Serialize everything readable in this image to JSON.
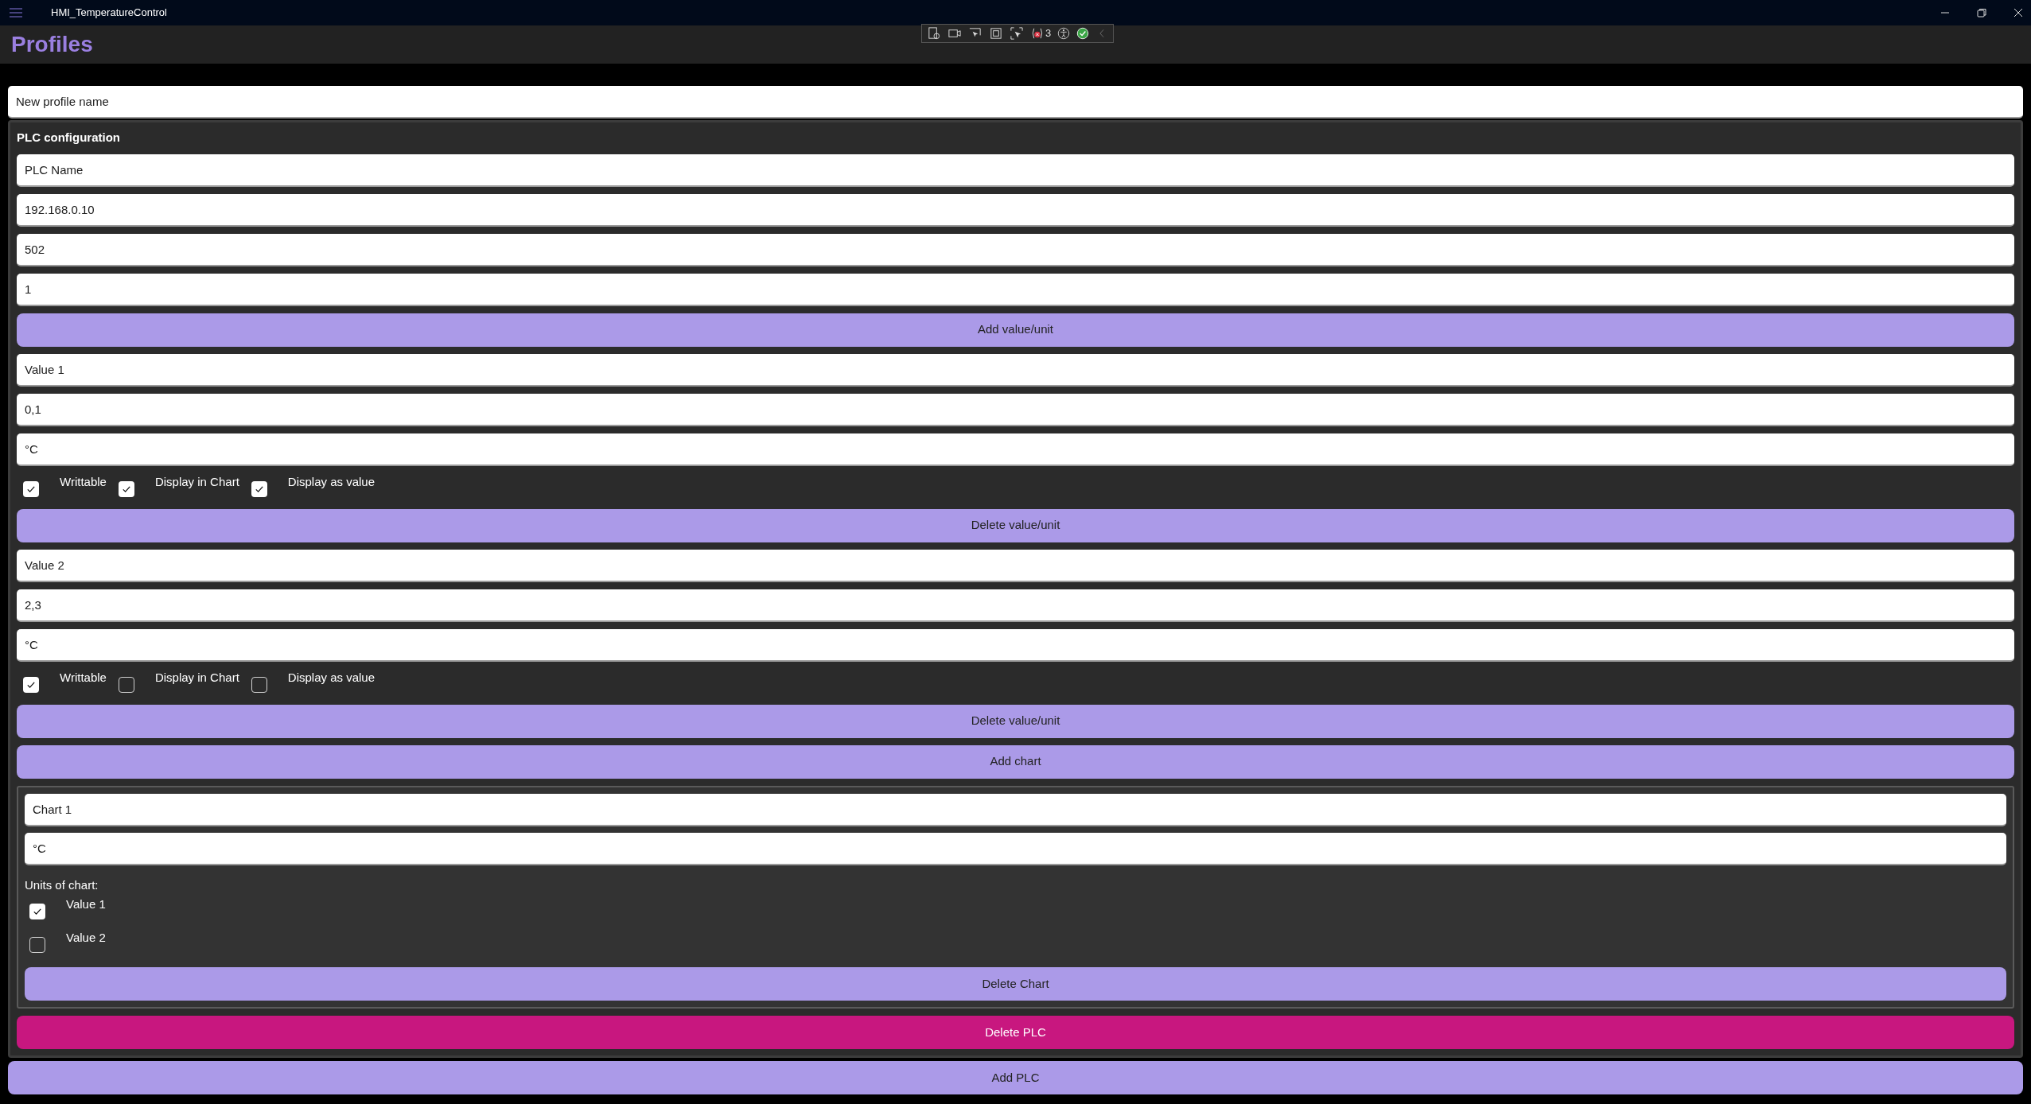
{
  "window": {
    "title": "HMI_TemperatureControl"
  },
  "page_title": "Profiles",
  "debug_toolbar": {
    "error_count": "3"
  },
  "profile_name": {
    "value": "New profile name"
  },
  "plc": {
    "heading": "PLC configuration",
    "fields": [
      {
        "value": "PLC Name"
      },
      {
        "value": "192.168.0.10"
      },
      {
        "value": "502"
      },
      {
        "value": "1"
      }
    ],
    "add_value_button": "Add value/unit",
    "values": [
      {
        "fields": [
          {
            "value": "Value 1"
          },
          {
            "value": "0,1"
          },
          {
            "value": "°C"
          }
        ],
        "options": [
          {
            "label": "Writtable",
            "checked": true
          },
          {
            "label": "Display in Chart",
            "checked": true
          },
          {
            "label": "Display as value",
            "checked": true
          }
        ],
        "delete_button": "Delete value/unit"
      },
      {
        "fields": [
          {
            "value": "Value 2"
          },
          {
            "value": "2,3"
          },
          {
            "value": "°C"
          }
        ],
        "options": [
          {
            "label": "Writtable",
            "checked": true
          },
          {
            "label": "Display in Chart",
            "checked": false
          },
          {
            "label": "Display as value",
            "checked": false
          }
        ],
        "delete_button": "Delete value/unit"
      }
    ],
    "add_chart_button": "Add chart",
    "charts": [
      {
        "fields": [
          {
            "value": "Chart 1"
          },
          {
            "value": "°C"
          }
        ],
        "units_label": "Units of chart:",
        "units": [
          {
            "label": "Value 1",
            "checked": true
          },
          {
            "label": "Value 2",
            "checked": false
          }
        ],
        "delete_button": "Delete Chart"
      }
    ],
    "delete_button": "Delete PLC"
  },
  "add_plc_button": "Add PLC"
}
